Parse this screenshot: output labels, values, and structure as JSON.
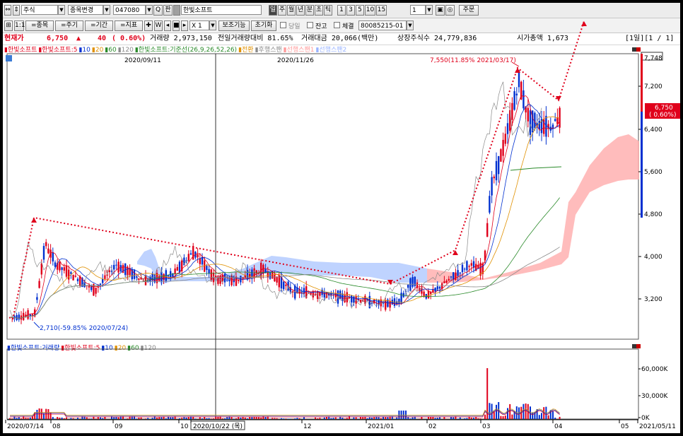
{
  "toolbar1": {
    "market_select": "주식",
    "code_change_label": "종목변경",
    "code_value": "047080",
    "search_label": "Q",
    "pan_label": "판",
    "stock_name": "한빛소프트",
    "periods": [
      "일",
      "주",
      "월",
      "년",
      "분",
      "초",
      "틱"
    ],
    "minute_buttons": [
      "1",
      "3",
      "5",
      "10",
      "15"
    ],
    "interval_value": "1",
    "order_label": "주문"
  },
  "toolbar2": {
    "items": [
      "=종목",
      "=주기",
      "=기간",
      "=지표"
    ],
    "multiplier_value": "X 1",
    "aux_label": "보조기능",
    "reset_label": "초기화",
    "same_day_label": "당일",
    "balance_label": "잔고",
    "exec_label": "체결",
    "account_value": "80085215-01"
  },
  "info": {
    "label": "현재가",
    "price": "6,750",
    "arrow": "▲",
    "change": "40",
    "change_pct": "( 0.60%)",
    "volume": "거래량 2,973,150",
    "prev_ratio": "전일거래량대비 81.65%",
    "amount": "거래대금 20,066(백만)",
    "shares": "상장주식수 24,779,836",
    "mktcap": "시가총액 1,673",
    "page": "[1일][1 / 1]"
  },
  "price_legend": [
    {
      "text": "한빛소프트",
      "color": "#e0001b"
    },
    {
      "text": "한빛소프트:5",
      "color": "#e0001b"
    },
    {
      "text": "10",
      "color": "#0030d0"
    },
    {
      "text": "20",
      "color": "#e09000"
    },
    {
      "text": "60",
      "color": "#2a8a2a"
    },
    {
      "text": "120",
      "color": "#8a8a8a"
    },
    {
      "text": "한빛소프트:기준선(26,9,26,52,26)",
      "color": "#2a8a2a"
    },
    {
      "text": "전환",
      "color": "#e09000"
    },
    {
      "text": "후행스팬",
      "color": "#8a8a8a"
    },
    {
      "text": "선행스팬1",
      "color": "#ff9a9a"
    },
    {
      "text": "선행스팬2",
      "color": "#9ab4ff"
    }
  ],
  "volume_legend": [
    {
      "text": "한빛소프트:거래량",
      "color": "#0030d0"
    },
    {
      "text": "한빛소프트:5",
      "color": "#e0001b"
    },
    {
      "text": "10",
      "color": "#0030d0"
    },
    {
      "text": "20",
      "color": "#e09000"
    },
    {
      "text": "60",
      "color": "#2a8a2a"
    },
    {
      "text": "120",
      "color": "#8a8a8a"
    }
  ],
  "price_axis": [
    "7,748",
    "7,200",
    "6,400",
    "5,600",
    "4,800",
    "4,000",
    "3,200"
  ],
  "current_price_tag": {
    "price": "6,750",
    "pct": "( 0.60%)"
  },
  "volume_axis": [
    "60,000K",
    "30,000K",
    "0K"
  ],
  "date_labels_top": [
    "2020/09/11",
    "2020/11/26"
  ],
  "annotation_high": "7,550(11.85% 2021/03/17)",
  "annotation_low": "2,710(-59.85% 2020/07/24)",
  "x_axis": [
    "2020/07/14",
    "08",
    "09",
    "10",
    "2020/10/22 (목)",
    "12",
    "2021/01",
    "02",
    "03",
    "04",
    "05",
    "2021/05/11"
  ],
  "colors": {
    "up": "#e0001b",
    "down": "#0030d0",
    "trend": "#e0001b"
  }
}
